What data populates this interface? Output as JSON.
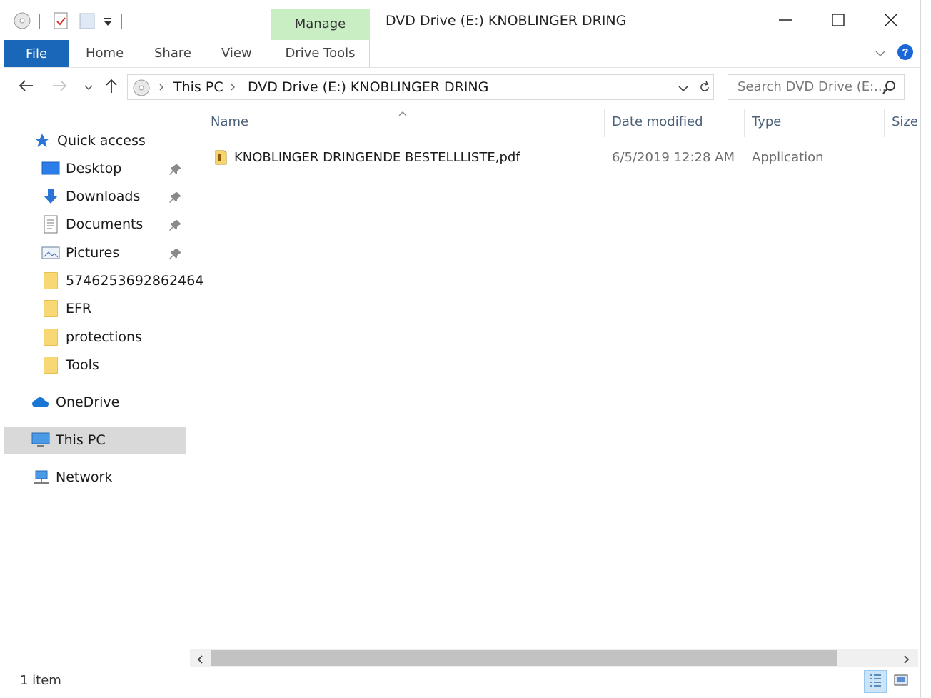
{
  "title_bar": {
    "window_title": "DVD Drive (E:) KNOBLINGER DRING",
    "context_tab_group": "Manage",
    "context_tab": "Drive Tools"
  },
  "ribbon": {
    "tabs": [
      "File",
      "Home",
      "Share",
      "View"
    ]
  },
  "address_bar": {
    "crumbs": [
      "This PC",
      "DVD Drive (E:) KNOBLINGER DRING"
    ]
  },
  "search": {
    "placeholder": "Search DVD Drive (E:..."
  },
  "nav_pane": {
    "quick_access": "Quick access",
    "pinned": [
      {
        "label": "Desktop",
        "icon": "desktop-icon"
      },
      {
        "label": "Downloads",
        "icon": "download-arrow-icon"
      },
      {
        "label": "Documents",
        "icon": "document-icon"
      },
      {
        "label": "Pictures",
        "icon": "pictures-icon"
      }
    ],
    "folders": [
      "5746253692862464",
      "EFR",
      "protections",
      "Tools"
    ],
    "onedrive": "OneDrive",
    "this_pc": "This PC",
    "network": "Network"
  },
  "columns": [
    "Name",
    "Date modified",
    "Type",
    "Size"
  ],
  "files": [
    {
      "name": "KNOBLINGER DRINGENDE BESTELLLISTE,pdf",
      "date_modified": "6/5/2019 12:28 AM",
      "type": "Application",
      "size": ""
    }
  ],
  "status_bar": {
    "item_count": "1 item"
  },
  "colors": {
    "accent": "#1a66b8",
    "manage_tab_bg": "#c9eec4",
    "selection_bg": "#d9d9d9",
    "folder_yellow": "#f8d775"
  }
}
